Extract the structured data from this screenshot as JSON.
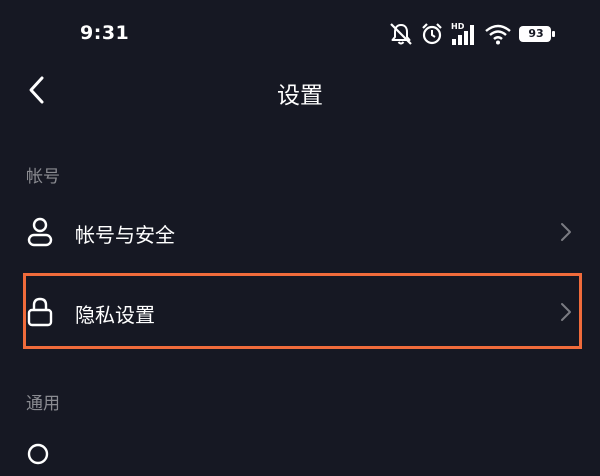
{
  "status_bar": {
    "time": "9:31",
    "hd_label": "HD",
    "battery_level": "93",
    "icons": [
      "mute-icon",
      "alarm-icon",
      "signal-icon",
      "wifi-icon",
      "battery-icon"
    ]
  },
  "nav": {
    "back_icon": "chevron-left-icon",
    "title": "设置"
  },
  "sections": [
    {
      "header": "帐号",
      "items": [
        {
          "label": "帐号与安全",
          "icon": "user-icon"
        },
        {
          "label": "隐私设置",
          "icon": "lock-icon",
          "highlighted": true
        }
      ]
    },
    {
      "header": "通用",
      "items": []
    }
  ],
  "colors": {
    "background": "#161823",
    "text": "#ffffff",
    "section_header": "#8a8b91",
    "chevron": "#7a7b82",
    "highlight": "#f06b3b"
  }
}
